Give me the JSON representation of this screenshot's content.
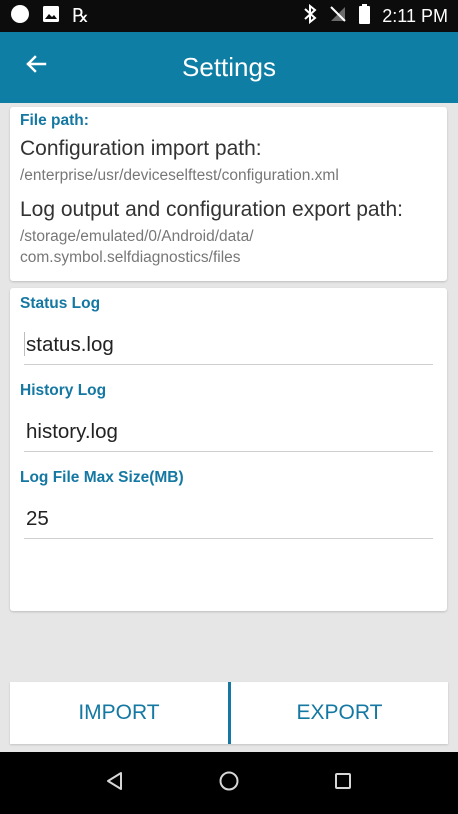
{
  "status_bar": {
    "time": "2:11 PM",
    "rx_symbol": "℞",
    "left_icons": [
      "circle-notification-icon",
      "image-icon",
      "prescription-icon"
    ],
    "right_icons": [
      "bluetooth-icon",
      "no-signal-icon",
      "battery-icon"
    ]
  },
  "app_bar": {
    "title": "Settings",
    "back_icon": "arrow-left-icon"
  },
  "file_path_card": {
    "label": "File path:",
    "import_heading": "Configuration import path:",
    "import_path": "/enterprise/usr/deviceselftest/configuration.xml",
    "export_heading": "Log output and configuration export path:",
    "export_path_line1": "/storage/emulated/0/Android/data/",
    "export_path_line2": "com.symbol.selfdiagnostics/files"
  },
  "log_settings_card": {
    "status_log_label": "Status Log",
    "status_log_value": "status.log",
    "history_log_label": "History Log",
    "history_log_value": "history.log",
    "max_size_label": "Log File Max Size(MB)",
    "max_size_value": "25"
  },
  "actions": {
    "import_label": "IMPORT",
    "export_label": "EXPORT"
  },
  "nav_bar": {
    "icons": [
      "triangle-back-icon",
      "circle-home-icon",
      "square-recents-icon"
    ]
  },
  "colors": {
    "app_bar": "#0e7ea4",
    "accent": "#1478a2",
    "background": "#e6e6e6",
    "status_bar": "#0c0c0c",
    "nav_bar": "#000000"
  }
}
